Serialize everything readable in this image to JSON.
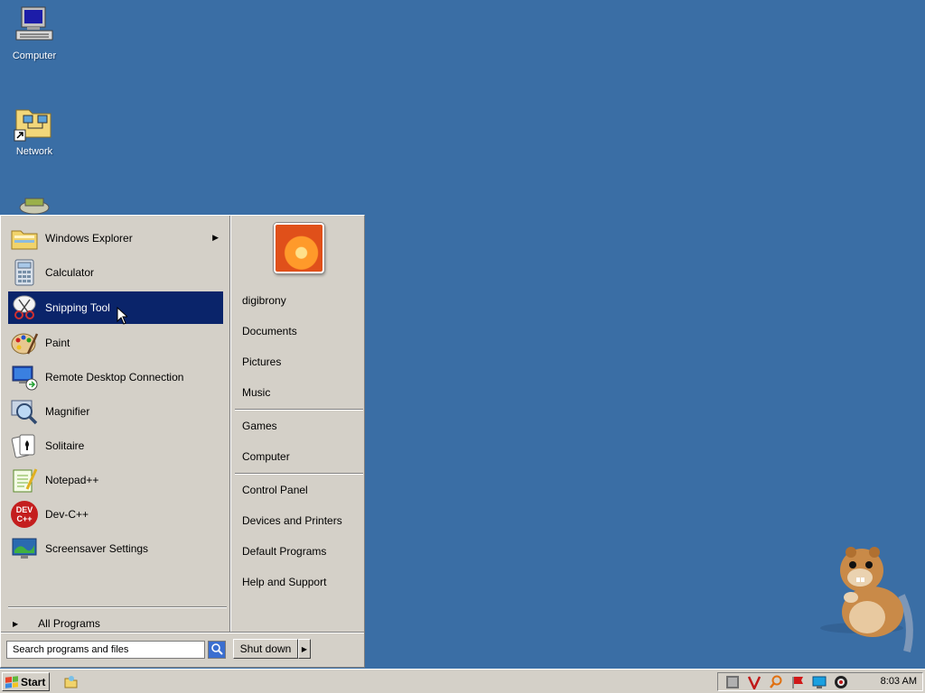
{
  "desktop": {
    "icons": [
      {
        "label": "Computer"
      },
      {
        "label": "Network"
      }
    ]
  },
  "start_menu": {
    "programs": [
      {
        "label": "Windows Explorer",
        "icon": "windows-explorer-icon",
        "has_submenu": true
      },
      {
        "label": "Calculator",
        "icon": "calculator-icon"
      },
      {
        "label": "Snipping Tool",
        "icon": "snipping-tool-icon",
        "selected": true
      },
      {
        "label": "Paint",
        "icon": "paint-icon"
      },
      {
        "label": "Remote Desktop Connection",
        "icon": "remote-desktop-icon"
      },
      {
        "label": "Magnifier",
        "icon": "magnifier-icon"
      },
      {
        "label": "Solitaire",
        "icon": "solitaire-icon"
      },
      {
        "label": "Notepad++",
        "icon": "notepadpp-icon"
      },
      {
        "label": "Dev-C++",
        "icon": "devcpp-icon"
      },
      {
        "label": "Screensaver Settings",
        "icon": "screensaver-icon"
      }
    ],
    "all_programs": "All Programs",
    "user_name": "digibrony",
    "right_items": {
      "documents": "Documents",
      "pictures": "Pictures",
      "music": "Music",
      "games": "Games",
      "computer": "Computer",
      "control_panel": "Control Panel",
      "devices_printers": "Devices and Printers",
      "default_programs": "Default Programs",
      "help_support": "Help and Support"
    },
    "search_placeholder": "Search programs and files",
    "shutdown_label": "Shut down"
  },
  "taskbar": {
    "start_label": "Start",
    "clock": "8:03 AM"
  },
  "colors": {
    "desktop": "#3a6ea5",
    "selection": "#0a246a",
    "chrome": "#d4d0c8"
  }
}
